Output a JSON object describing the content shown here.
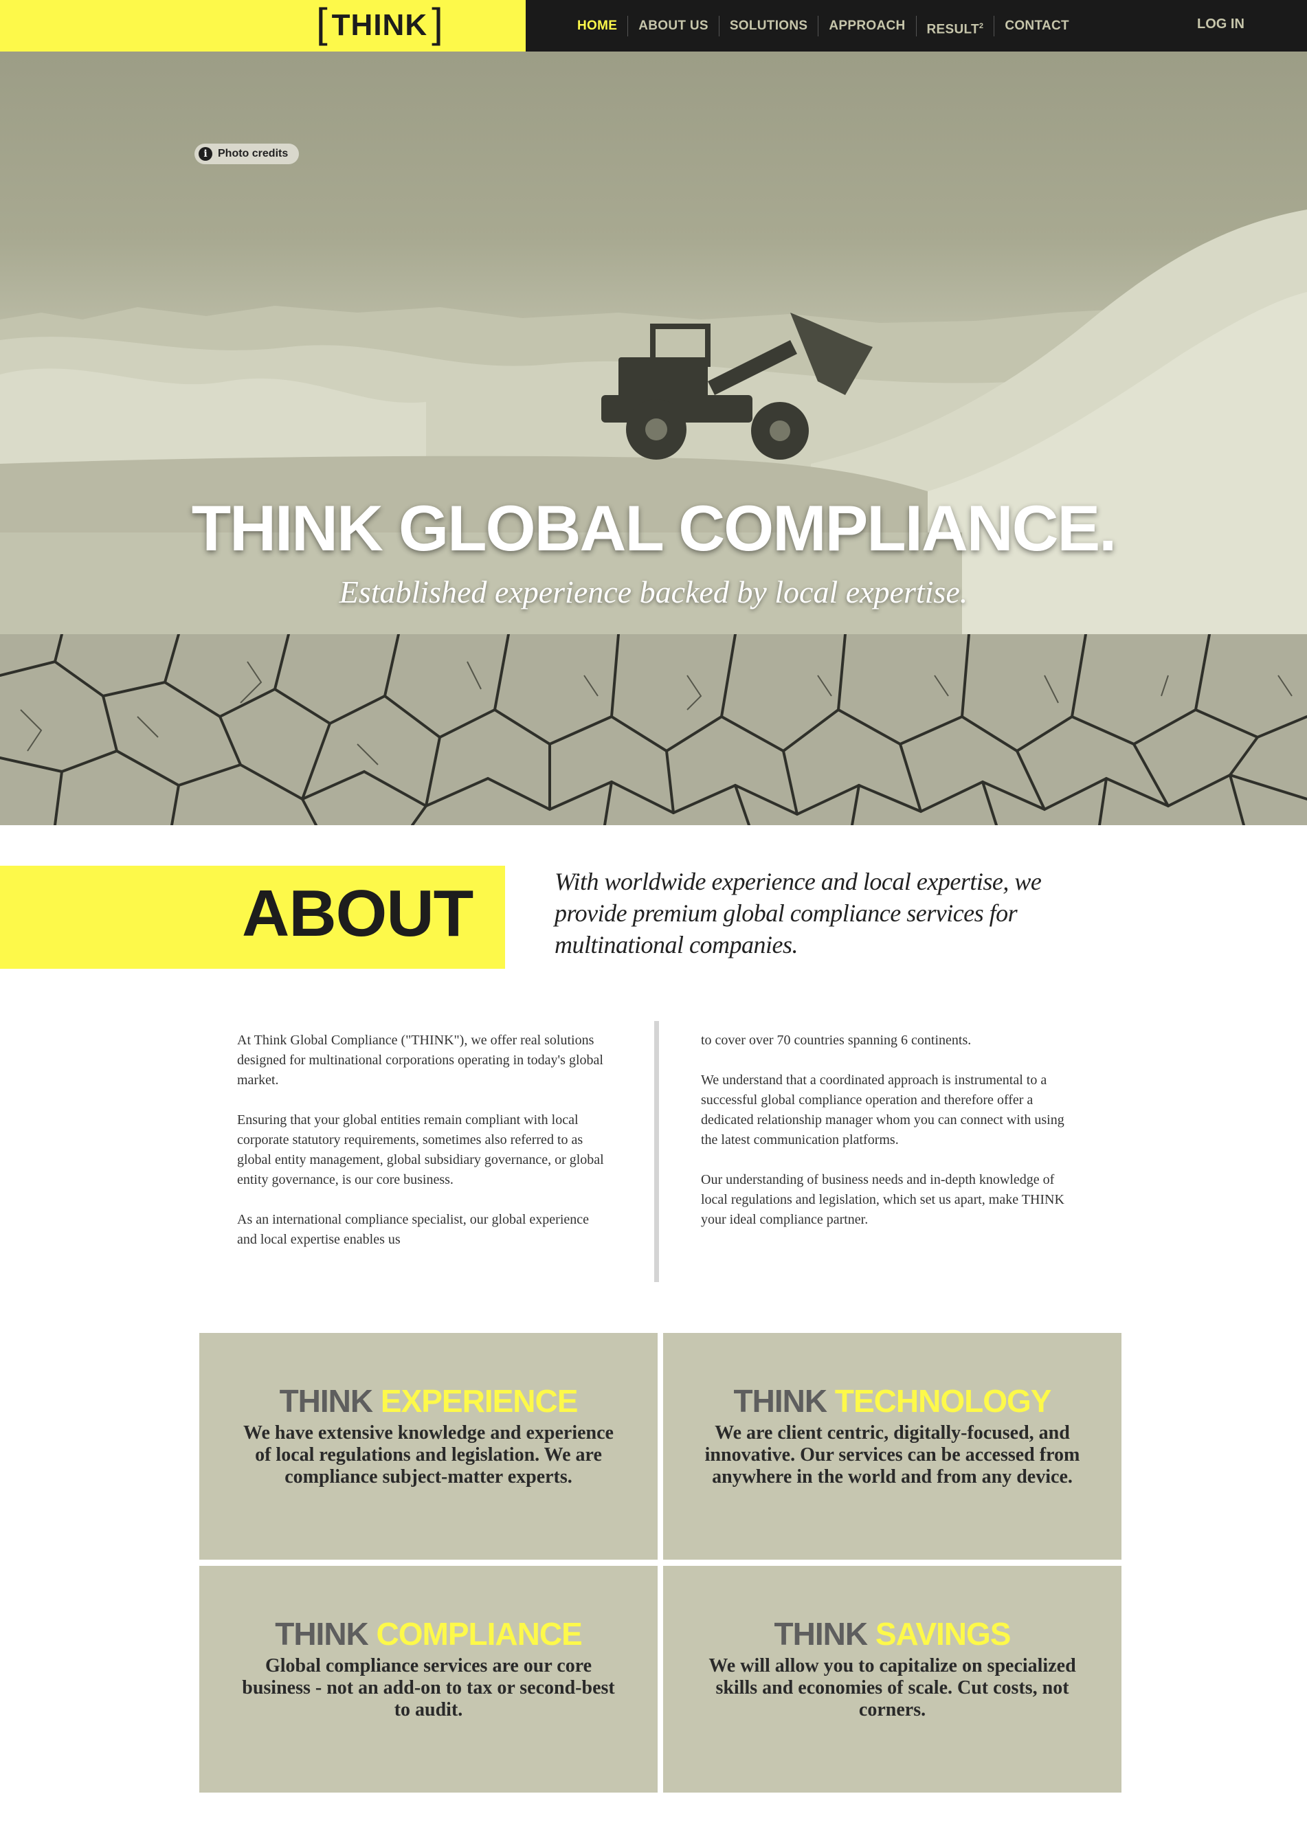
{
  "nav": {
    "logo_text": "THINK",
    "items": [
      {
        "label": "HOME",
        "active": true
      },
      {
        "label": "ABOUT US",
        "active": false
      },
      {
        "label": "SOLUTIONS",
        "active": false
      },
      {
        "label": "APPROACH",
        "active": false
      },
      {
        "label": "RESULT",
        "sup": "2",
        "active": false
      },
      {
        "label": "CONTACT",
        "active": false
      }
    ],
    "login": "LOG IN"
  },
  "hero": {
    "photo_credits": "Photo credits",
    "title": "THINK GLOBAL COMPLIANCE.",
    "subtitle": "Established experience backed by local expertise."
  },
  "about": {
    "title": "ABOUT",
    "tagline": "With worldwide experience and local expertise, we provide premium global compliance services for multinational companies.",
    "left_paragraphs": [
      "At Think Global Compliance (\"THINK\"), we offer real solutions designed for multinational corporations operating in today's global market.",
      "Ensuring that your global entities remain compliant with local corporate statutory requirements, sometimes also referred to as global entity management, global subsidiary governance, or global entity governance, is our core business.",
      "As an international compliance specialist, our global experience and local expertise enables us"
    ],
    "right_paragraphs": [
      "to cover over 70 countries spanning 6 continents.",
      "We understand that a coordinated approach is instrumental to a successful global compliance operation and therefore offer a dedicated relationship manager whom you can connect with using the latest communication platforms.",
      "Our understanding of business needs and in-depth knowledge of local regulations and legislation, which set us apart, make THINK your ideal compliance partner."
    ]
  },
  "boxes": [
    {
      "prefix": "THINK",
      "word": "EXPERIENCE",
      "text": "We have extensive knowledge and experience of local regulations and legislation. We are compliance subject-matter experts."
    },
    {
      "prefix": "THINK",
      "word": "TECHNOLOGY",
      "text": "We are client centric, digitally-focused, and innovative. Our services can be accessed from anywhere in the world and from any device."
    },
    {
      "prefix": "THINK",
      "word": "COMPLIANCE",
      "text": "Global compliance services are our core business - not an add-on to tax or second-best to audit."
    },
    {
      "prefix": "THINK",
      "word": "SAVINGS",
      "text": "We will allow you to capitalize on specialized skills and economies of scale. Cut costs, not corners."
    }
  ],
  "colors": {
    "accent_yellow": "#fdf94a",
    "nav_bg": "#1a1a1a",
    "box_bg": "#c6c6b0"
  }
}
